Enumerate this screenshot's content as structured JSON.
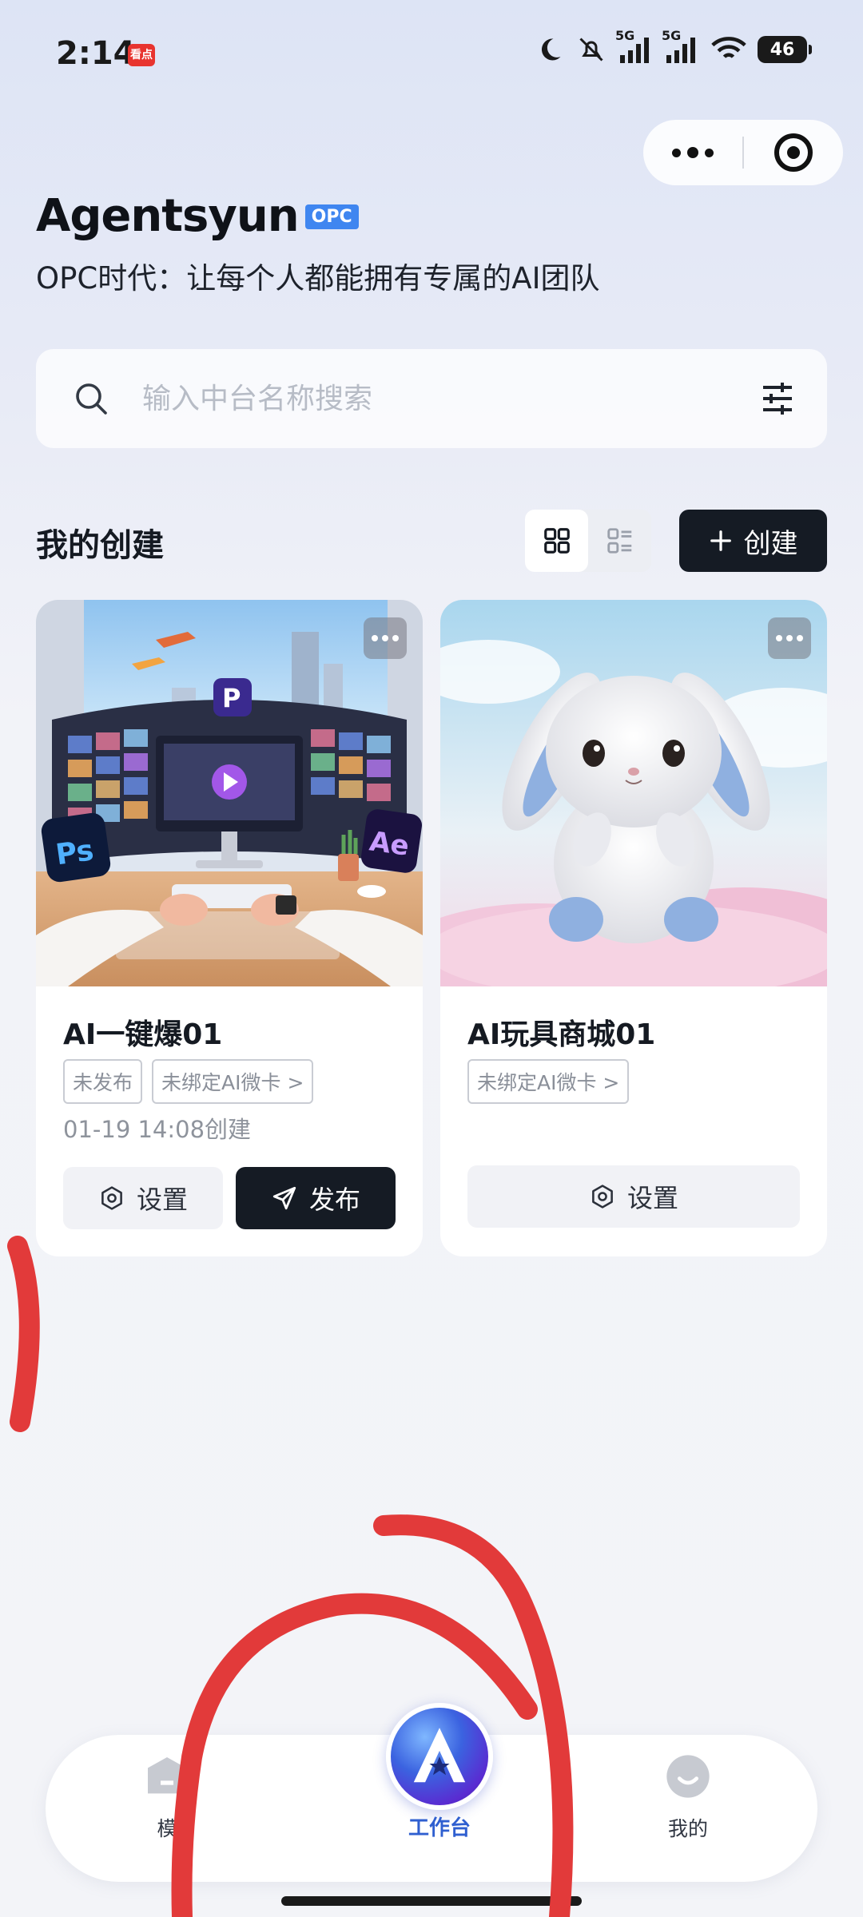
{
  "status_bar": {
    "time": "2:14",
    "app_badge": "看点",
    "signal_1": "5G",
    "signal_2": "5G",
    "battery": "46"
  },
  "header": {
    "title": "Agentsyun",
    "badge": "OPC",
    "tagline": "OPC时代：让每个人都能拥有专属的AI团队"
  },
  "search": {
    "placeholder": "输入中台名称搜索"
  },
  "section": {
    "title": "我的创建",
    "create_label": "创建"
  },
  "cards": [
    {
      "title": "AI一键爆01",
      "tags": [
        "未发布",
        "未绑定AI微卡 >"
      ],
      "created": "01-19 14:08创建",
      "settings_label": "设置",
      "publish_label": "发布"
    },
    {
      "title": "AI玩具商城01",
      "tags": [
        "未绑定AI微卡 >"
      ],
      "settings_label": "设置"
    }
  ],
  "card_image_1": {
    "badge_p": "P",
    "badge_ps": "Ps",
    "badge_ae": "Ae"
  },
  "nav": {
    "templates": "模",
    "workbench": "工作台",
    "mine": "我的"
  },
  "colors": {
    "primary_dark": "#151b24",
    "accent_blue": "#3f86f0",
    "nav_active": "#2f5fd0",
    "annotation_red": "#e23a3a"
  }
}
